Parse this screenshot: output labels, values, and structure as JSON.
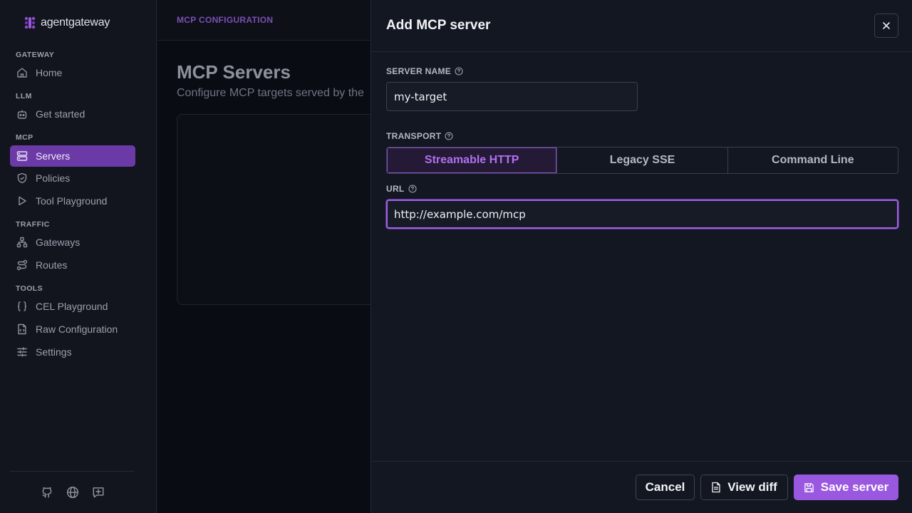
{
  "app": {
    "logo_text": "agentgateway"
  },
  "sidebar": {
    "sections": [
      {
        "title": "GATEWAY",
        "items": [
          {
            "label": "Home",
            "icon": "home-icon"
          }
        ]
      },
      {
        "title": "LLM",
        "items": [
          {
            "label": "Get started",
            "icon": "bot-icon"
          }
        ]
      },
      {
        "title": "MCP",
        "items": [
          {
            "label": "Servers",
            "icon": "server-icon",
            "active": true
          },
          {
            "label": "Policies",
            "icon": "shield-icon"
          },
          {
            "label": "Tool Playground",
            "icon": "play-icon"
          }
        ]
      },
      {
        "title": "TRAFFIC",
        "items": [
          {
            "label": "Gateways",
            "icon": "network-icon"
          },
          {
            "label": "Routes",
            "icon": "route-icon"
          }
        ]
      },
      {
        "title": "TOOLS",
        "items": [
          {
            "label": "CEL Playground",
            "icon": "braces-icon"
          },
          {
            "label": "Raw Configuration",
            "icon": "file-code-icon"
          },
          {
            "label": "Settings",
            "icon": "sliders-icon"
          }
        ]
      }
    ],
    "footer_icons": [
      "github-icon",
      "globe-icon",
      "feedback-icon"
    ]
  },
  "main": {
    "breadcrumb": "MCP CONFIGURATION",
    "title": "MCP Servers",
    "subtitle": "Configure MCP targets served by the"
  },
  "drawer": {
    "title": "Add MCP server",
    "server_name": {
      "label": "SERVER NAME",
      "value": "my-target"
    },
    "transport": {
      "label": "TRANSPORT",
      "options": [
        "Streamable HTTP",
        "Legacy SSE",
        "Command Line"
      ],
      "selected": "Streamable HTTP"
    },
    "url": {
      "label": "URL",
      "value": "http://example.com/mcp"
    },
    "buttons": {
      "cancel": "Cancel",
      "view_diff": "View diff",
      "save": "Save server"
    }
  },
  "colors": {
    "accent": "#9a57e0",
    "sidebar_active": "#6b3aa7",
    "breadcrumb": "#7a4fb3"
  }
}
